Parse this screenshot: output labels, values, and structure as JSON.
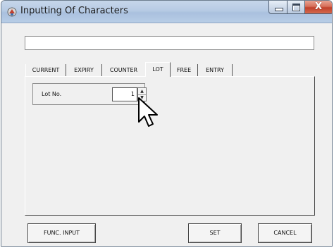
{
  "window": {
    "title": "Inputting Of Characters",
    "close_glyph": "X"
  },
  "text_field": {
    "value": ""
  },
  "tabs": [
    {
      "label": "CURRENT",
      "active": false
    },
    {
      "label": "EXPIRY",
      "active": false
    },
    {
      "label": "COUNTER",
      "active": false
    },
    {
      "label": "LOT",
      "active": true
    },
    {
      "label": "FREE",
      "active": false
    },
    {
      "label": "ENTRY",
      "active": false
    }
  ],
  "lot": {
    "label": "Lot No.",
    "value": "1",
    "spin_up": "▲",
    "spin_down": "▼"
  },
  "buttons": {
    "func_input": "FUNC. INPUT",
    "set": "SET",
    "cancel": "CANCEL"
  },
  "icons": {
    "app": "app-icon",
    "cursor": "mouse-pointer-icon"
  }
}
